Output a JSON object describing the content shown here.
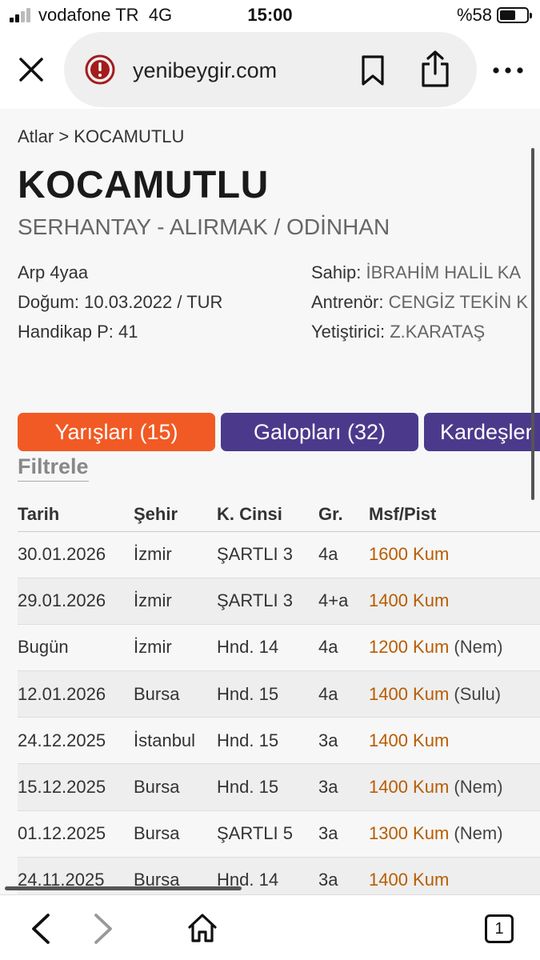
{
  "status_bar": {
    "carrier": "vodafone TR",
    "network": "4G",
    "time": "15:00",
    "battery": "%58",
    "battery_level": 0.58
  },
  "browser": {
    "url": "yenibeygir.com",
    "icons": [
      "close-icon",
      "warning-icon",
      "bookmark-icon",
      "share-icon",
      "more-icon"
    ],
    "tab_count": "1"
  },
  "page": {
    "breadcrumb": "Atlar > KOCAMUTLU",
    "horse_name": "KOCAMUTLU",
    "pedigree": "SERHANTAY - ALIRMAK / ODİNHAN",
    "info_left": [
      "Arp 4yaa",
      "Doğum: 10.03.2022 / TUR",
      "Handikap P: 41"
    ],
    "info_right": [
      {
        "key": "Sahip: ",
        "value": "İBRAHİM HALİL KA"
      },
      {
        "key": "Antrenör: ",
        "value": "CENGİZ TEKİN K"
      },
      {
        "key": "Yetiştirici: ",
        "value": "Z.KARATAŞ"
      }
    ],
    "tabs": {
      "races": "Yarışları (15)",
      "gallops": "Galopları (32)",
      "siblings": "Kardeşler"
    },
    "filter": "Filtrele",
    "colors": {
      "active_tab": "#f15a24",
      "inactive_tab": "#4b3a8c",
      "distance": "#b85c00"
    },
    "table": {
      "headers": [
        "Tarih",
        "Şehir",
        "K. Cinsi",
        "Gr.",
        "Msf/Pist"
      ],
      "rows": [
        {
          "date": "30.01.2026",
          "city": "İzmir",
          "type": "ŞARTLI 3",
          "group": "4a",
          "dist": "1600 Kum",
          "cond": ""
        },
        {
          "date": "29.01.2026",
          "city": "İzmir",
          "type": "ŞARTLI 3",
          "group": "4+a",
          "dist": "1400 Kum",
          "cond": ""
        },
        {
          "date": "Bugün",
          "city": "İzmir",
          "type": "Hnd. 14",
          "group": "4a",
          "dist": "1200 Kum",
          "cond": "(Nem)"
        },
        {
          "date": "12.01.2026",
          "city": "Bursa",
          "type": "Hnd. 15",
          "group": "4a",
          "dist": "1400 Kum",
          "cond": "(Sulu)"
        },
        {
          "date": "24.12.2025",
          "city": "İstanbul",
          "type": "Hnd. 15",
          "group": "3a",
          "dist": "1400 Kum",
          "cond": ""
        },
        {
          "date": "15.12.2025",
          "city": "Bursa",
          "type": "Hnd. 15",
          "group": "3a",
          "dist": "1400 Kum",
          "cond": "(Nem)"
        },
        {
          "date": "01.12.2025",
          "city": "Bursa",
          "type": "ŞARTLI 5",
          "group": "3a",
          "dist": "1300 Kum",
          "cond": "(Nem)"
        },
        {
          "date": "24.11.2025",
          "city": "Bursa",
          "type": "Hnd. 14",
          "group": "3a",
          "dist": "1400 Kum",
          "cond": ""
        }
      ]
    }
  }
}
